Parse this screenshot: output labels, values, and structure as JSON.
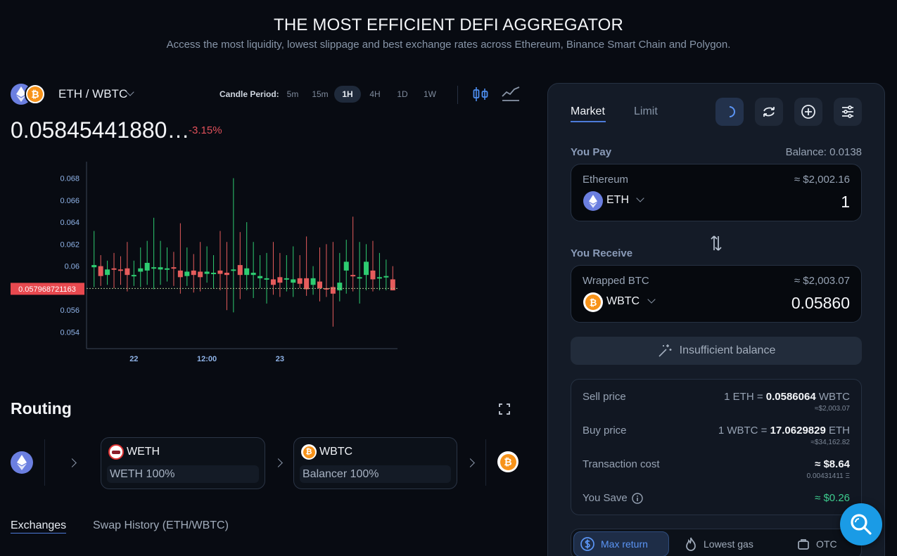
{
  "hero": {
    "title": "THE MOST EFFICIENT DEFI AGGREGATOR",
    "subtitle": "Access the most liquidity, lowest slippage and best exchange rates across Ethereum, Binance Smart Chain and Polygon."
  },
  "pair": {
    "name": "ETH / WBTC",
    "price": "0.05845441880…",
    "change": "-3.15%",
    "candle_period_label": "Candle Period:",
    "periods": [
      "5m",
      "15m",
      "1H",
      "4H",
      "1D",
      "1W"
    ],
    "active_period": "1H"
  },
  "chart_data": {
    "type": "candlestick",
    "y_ticks": [
      "0.068",
      "0.066",
      "0.064",
      "0.062",
      "0.06",
      "0.058",
      "0.056",
      "0.054"
    ],
    "x_ticks": [
      "22",
      "12:00",
      "23"
    ],
    "current_price_label": "0.057968721163",
    "current_price": 0.05797,
    "ylim": [
      0.0525,
      0.0695
    ],
    "colors": {
      "up": "#2ecc71",
      "down": "#e65c5c"
    },
    "candles": [
      {
        "o": 0.0599,
        "c": 0.0601,
        "h": 0.0632,
        "l": 0.0581
      },
      {
        "o": 0.06,
        "c": 0.0591,
        "h": 0.061,
        "l": 0.0582
      },
      {
        "o": 0.0592,
        "c": 0.0597,
        "h": 0.0605,
        "l": 0.0583
      },
      {
        "o": 0.0598,
        "c": 0.0597,
        "h": 0.0612,
        "l": 0.058
      },
      {
        "o": 0.0597,
        "c": 0.0596,
        "h": 0.0609,
        "l": 0.0583
      },
      {
        "o": 0.0598,
        "c": 0.0592,
        "h": 0.0622,
        "l": 0.0577
      },
      {
        "o": 0.0591,
        "c": 0.0592,
        "h": 0.0605,
        "l": 0.0582
      },
      {
        "o": 0.0595,
        "c": 0.0598,
        "h": 0.0617,
        "l": 0.0581
      },
      {
        "o": 0.0596,
        "c": 0.0603,
        "h": 0.0623,
        "l": 0.0583
      },
      {
        "o": 0.0598,
        "c": 0.0599,
        "h": 0.0644,
        "l": 0.0579
      },
      {
        "o": 0.0597,
        "c": 0.0599,
        "h": 0.0623,
        "l": 0.0583
      },
      {
        "o": 0.0598,
        "c": 0.0598,
        "h": 0.0617,
        "l": 0.0586
      },
      {
        "o": 0.0599,
        "c": 0.0598,
        "h": 0.0613,
        "l": 0.0582
      },
      {
        "o": 0.0596,
        "c": 0.059,
        "h": 0.0639,
        "l": 0.0575
      },
      {
        "o": 0.0591,
        "c": 0.0595,
        "h": 0.0617,
        "l": 0.0582
      },
      {
        "o": 0.0596,
        "c": 0.0592,
        "h": 0.0611,
        "l": 0.0576
      },
      {
        "o": 0.0595,
        "c": 0.059,
        "h": 0.0622,
        "l": 0.0577
      },
      {
        "o": 0.0593,
        "c": 0.0595,
        "h": 0.0618,
        "l": 0.0585
      },
      {
        "o": 0.0594,
        "c": 0.0594,
        "h": 0.061,
        "l": 0.058
      },
      {
        "o": 0.0596,
        "c": 0.0593,
        "h": 0.0632,
        "l": 0.0578
      },
      {
        "o": 0.0594,
        "c": 0.0592,
        "h": 0.0622,
        "l": 0.056
      },
      {
        "o": 0.0597,
        "c": 0.0597,
        "h": 0.068,
        "l": 0.0558
      },
      {
        "o": 0.0601,
        "c": 0.0592,
        "h": 0.0631,
        "l": 0.057
      },
      {
        "o": 0.0592,
        "c": 0.0598,
        "h": 0.064,
        "l": 0.0578
      },
      {
        "o": 0.0592,
        "c": 0.0594,
        "h": 0.0622,
        "l": 0.0571
      },
      {
        "o": 0.0589,
        "c": 0.0591,
        "h": 0.061,
        "l": 0.058
      },
      {
        "o": 0.0589,
        "c": 0.0589,
        "h": 0.0612,
        "l": 0.0566
      },
      {
        "o": 0.0588,
        "c": 0.0583,
        "h": 0.0622,
        "l": 0.0574
      },
      {
        "o": 0.059,
        "c": 0.0585,
        "h": 0.0612,
        "l": 0.0572
      },
      {
        "o": 0.0588,
        "c": 0.0589,
        "h": 0.061,
        "l": 0.0577
      },
      {
        "o": 0.0585,
        "c": 0.0588,
        "h": 0.0618,
        "l": 0.0572
      },
      {
        "o": 0.0589,
        "c": 0.0584,
        "h": 0.061,
        "l": 0.058
      },
      {
        "o": 0.0589,
        "c": 0.0579,
        "h": 0.0627,
        "l": 0.0573
      },
      {
        "o": 0.0583,
        "c": 0.0589,
        "h": 0.06,
        "l": 0.0574
      },
      {
        "o": 0.0586,
        "c": 0.058,
        "h": 0.0617,
        "l": 0.0568
      },
      {
        "o": 0.058,
        "c": 0.0579,
        "h": 0.062,
        "l": 0.0572
      },
      {
        "o": 0.0581,
        "c": 0.0575,
        "h": 0.0622,
        "l": 0.0545
      },
      {
        "o": 0.0578,
        "c": 0.0585,
        "h": 0.0612,
        "l": 0.0568
      },
      {
        "o": 0.0596,
        "c": 0.0604,
        "h": 0.0624,
        "l": 0.0575
      },
      {
        "o": 0.0592,
        "c": 0.0591,
        "h": 0.0645,
        "l": 0.0577
      },
      {
        "o": 0.059,
        "c": 0.059,
        "h": 0.0622,
        "l": 0.0566
      },
      {
        "o": 0.0592,
        "c": 0.0604,
        "h": 0.062,
        "l": 0.0578
      },
      {
        "o": 0.0596,
        "c": 0.0588,
        "h": 0.0623,
        "l": 0.0577
      },
      {
        "o": 0.059,
        "c": 0.059,
        "h": 0.0612,
        "l": 0.0578
      },
      {
        "o": 0.0591,
        "c": 0.0591,
        "h": 0.0606,
        "l": 0.0578
      },
      {
        "o": 0.0588,
        "c": 0.0578,
        "h": 0.06,
        "l": 0.0578
      }
    ]
  },
  "routing": {
    "title": "Routing",
    "steps": [
      {
        "token": "WETH",
        "detail": "WETH 100%"
      },
      {
        "token": "WBTC",
        "detail": "Balancer 100%"
      }
    ]
  },
  "bottom_tabs": {
    "exchanges": "Exchanges",
    "history": "Swap History (ETH/WBTC)"
  },
  "swap": {
    "tab_market": "Market",
    "tab_limit": "Limit",
    "you_pay": "You Pay",
    "balance": "Balance: 0.0138",
    "pay_name": "Ethereum",
    "pay_usd": "≈ $2,002.16",
    "pay_symbol": "ETH",
    "pay_amount": "1",
    "you_receive": "You Receive",
    "receive_name": "Wrapped BTC",
    "receive_usd": "≈ $2,003.07",
    "receive_symbol": "WBTC",
    "receive_amount": "0.05860",
    "button": "Insufficient balance"
  },
  "details": {
    "sell_label": "Sell price",
    "sell_prefix": "1 ETH = ",
    "sell_value": "0.0586064",
    "sell_unit": " WBTC",
    "sell_sub": "≈$2,003.07",
    "buy_label": "Buy price",
    "buy_prefix": "1 WBTC = ",
    "buy_value": "17.0629829",
    "buy_unit": " ETH",
    "buy_sub": "≈$34,162.82",
    "tx_label": "Transaction cost",
    "tx_value": "≈ $8.64",
    "tx_sub": "0.00431411 Ξ",
    "save_label": "You Save",
    "save_value": "≈ $0.26"
  },
  "route_options": {
    "max_return": "Max return",
    "lowest_gas": "Lowest gas",
    "otc": "OTC"
  },
  "icons": {
    "eth_color": "#6b7fe0",
    "btc_color": "#f7931a"
  }
}
